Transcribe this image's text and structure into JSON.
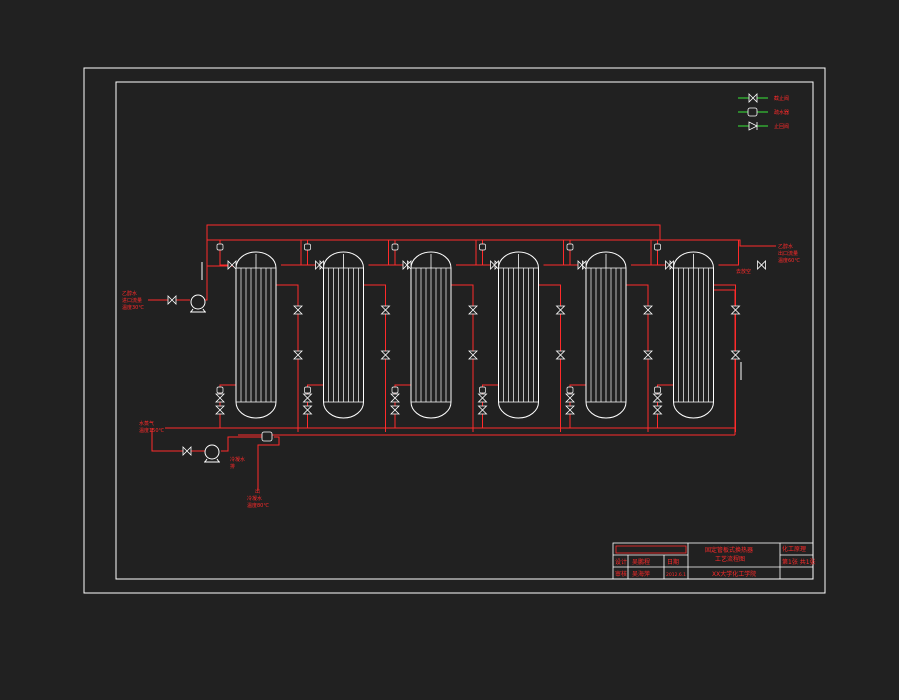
{
  "colors": {
    "background": "#212121",
    "line_white": "#ffffff",
    "line_red": "#ff2a2a",
    "line_green": "#39e639"
  },
  "legend": {
    "items": [
      {
        "icon": "gate-valve-icon",
        "label": "截止阀"
      },
      {
        "icon": "steam-trap-icon",
        "label": "疏水器"
      },
      {
        "icon": "check-valve-icon",
        "label": "止回阀"
      }
    ]
  },
  "labels": {
    "inlet_tl": [
      "乙醇水",
      "进口流量",
      "温度30℃"
    ],
    "outlet_tr": [
      "乙醇水",
      "出口流量",
      "温度60℃"
    ],
    "vent_tr": "去放空",
    "steam_in": [
      "水蒸气",
      "温度150℃"
    ],
    "drain": [
      "冷凝水",
      "排"
    ],
    "cond_out": [
      "出",
      "冷凝水",
      "温度80℃"
    ]
  },
  "exchangers": {
    "count": 6
  },
  "title_block": {
    "title_line1": "固定管板式换热器",
    "title_line2": "工艺流程图",
    "designer_role": "设计",
    "designer_name": "吴鹏程",
    "checker_role": "审核",
    "checker_name": "吴海萍",
    "date_label": "日期",
    "date_value": "2012.6.1",
    "school": "XX大学化工学院",
    "right_top": "化工原理",
    "right_bottom": "第1张 共1张"
  }
}
